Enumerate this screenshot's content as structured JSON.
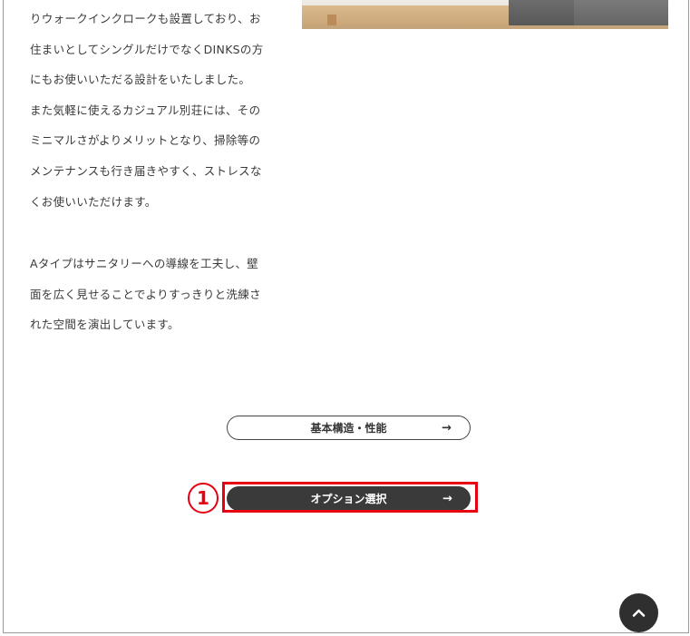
{
  "content": {
    "paragraph1_lines": [
      "りウォークインクロークも設置しており、お",
      "住まいとしてシングルだけでなくDINKSの方",
      "にもお使いいただる設計をいたしました。",
      "また気軽に使えるカジュアル別荘には、その",
      "ミニマルさがよりメリットとなり、掃除等の",
      "メンテナンスも行き届きやすく、ストレスな",
      "くお使いいただけます。"
    ],
    "paragraph2_lines": [
      "Aタイプはサニタリーへの導線を工夫し、壁",
      "面を広く見せることでよりすっきりと洗練さ",
      "れた空間を演出しています。"
    ]
  },
  "buttons": {
    "structure_label": "基本構造・性能",
    "option_label": "オプション選択",
    "arrow": "→"
  },
  "annotation": {
    "step_number": "1",
    "highlight_color": "#e60012"
  },
  "icons": {
    "back_to_top": "chevron-up-icon"
  }
}
